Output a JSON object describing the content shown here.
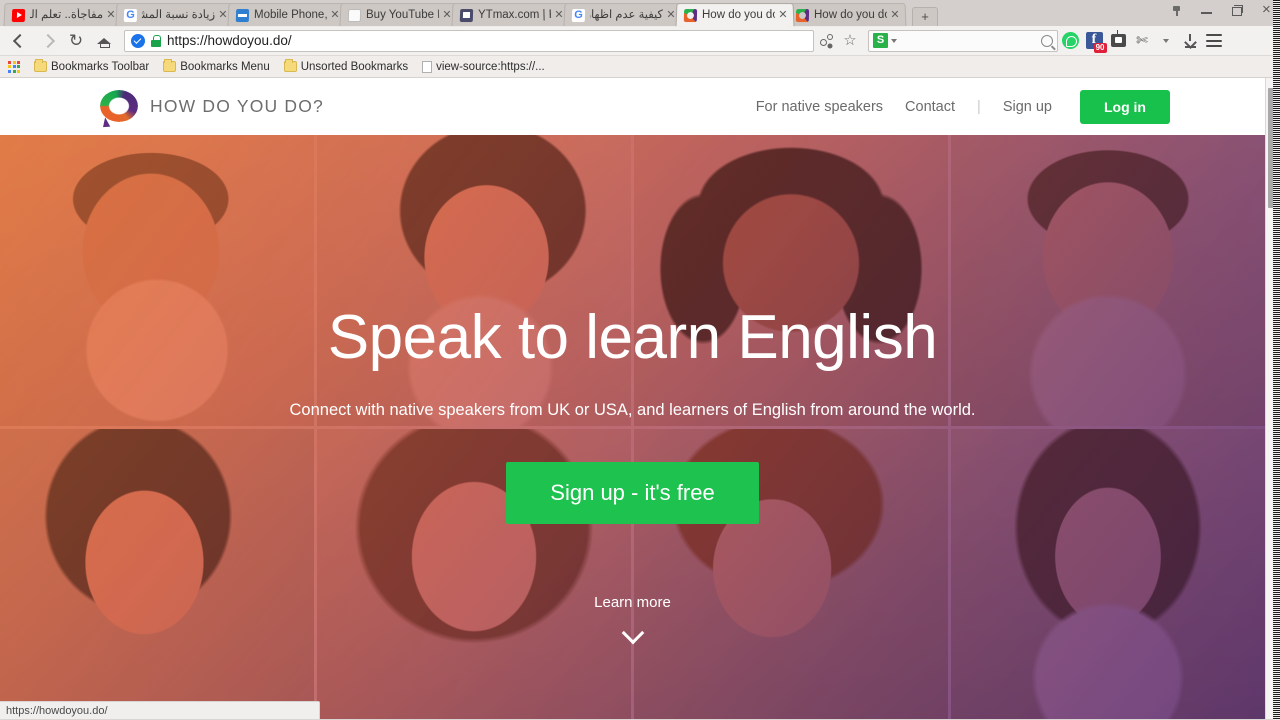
{
  "browser": {
    "tabs": [
      {
        "title": "مفاجأة.. تعلم اللغ",
        "favicon": "youtube-icon",
        "rtl": true,
        "active": false
      },
      {
        "title": "زيادة نسبة المشاه",
        "favicon": "google-icon",
        "rtl": true,
        "active": false
      },
      {
        "title": "Mobile Phone, N",
        "favicon": "blue-site-icon",
        "rtl": false,
        "active": false
      },
      {
        "title": "Buy YouTube Lik",
        "favicon": "page-icon",
        "rtl": false,
        "active": false
      },
      {
        "title": "YTmax.com | Fre",
        "favicon": "ytmax-icon",
        "rtl": false,
        "active": false
      },
      {
        "title": "كيفية عدم اظهار ا",
        "favicon": "google-icon",
        "rtl": true,
        "active": false
      },
      {
        "title": "How do you do?",
        "favicon": "howdoyoudo-icon",
        "rtl": false,
        "active": true
      },
      {
        "title": "How do you do?",
        "favicon": "howdoyoudo-icon",
        "rtl": false,
        "active": false
      }
    ],
    "new_tab_label": "+",
    "window_controls": [
      "pin-icon",
      "minimize-icon",
      "restore-icon",
      "close-icon"
    ],
    "toolbar": {
      "back_label": "back-arrow-icon",
      "forward_label": "forward-arrow-icon",
      "reload_label": "↻",
      "home_label": "home-icon",
      "url": "https://howdoyou.do/",
      "security_label": "secure-lock-icon",
      "search_engine_badge": "S",
      "facebook_badge_count": "90"
    },
    "bookmarks": [
      {
        "label": "Bookmarks Toolbar",
        "icon": "folder-icon"
      },
      {
        "label": "Bookmarks Menu",
        "icon": "folder-icon"
      },
      {
        "label": "Unsorted Bookmarks",
        "icon": "folder-icon"
      },
      {
        "label": "view-source:https://...",
        "icon": "document-icon"
      }
    ],
    "status_text": "https://howdoyou.do/"
  },
  "site": {
    "logo_text": "HOW DO YOU DO?",
    "nav": {
      "native_speakers": "For native speakers",
      "contact": "Contact",
      "separator": "|",
      "sign_up": "Sign up",
      "log_in": "Log in"
    },
    "hero": {
      "headline": "Speak to learn English",
      "subhead": "Connect with native speakers from UK or USA, and learners of English from around the world.",
      "cta": "Sign up - it's free",
      "learn_more": "Learn more",
      "chevron": "chevron-down-icon"
    }
  },
  "colors": {
    "brand_green": "#17c14b",
    "cta_green": "#1ec24e",
    "hero_gradient_start": "#ec6c30",
    "hero_gradient_end": "#5c2d82",
    "facebook_blue": "#3b5998",
    "badge_red": "#e0203a"
  }
}
